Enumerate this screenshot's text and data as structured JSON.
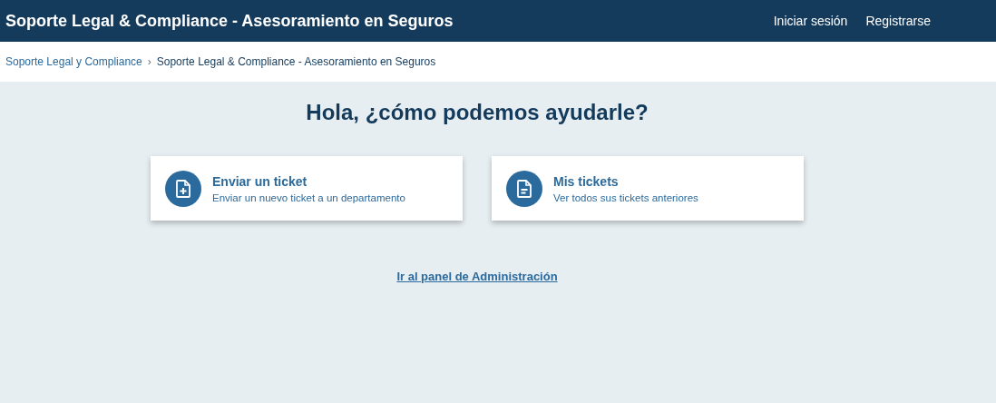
{
  "header": {
    "title": "Soporte Legal & Compliance - Asesoramiento en Seguros",
    "links": [
      "Iniciar sesión",
      "Registrarse"
    ]
  },
  "breadcrumb": {
    "items": [
      "Soporte Legal y Compliance",
      "Soporte Legal & Compliance - Asesoramiento en Seguros"
    ],
    "separator": "›"
  },
  "heading": "Hola, ¿cómo podemos ayudarle?",
  "cards": [
    {
      "kind": "new",
      "title": "Enviar un ticket",
      "subtitle": "Enviar un nuevo ticket a un departamento"
    },
    {
      "kind": "list",
      "title": "Mis tickets",
      "subtitle": "Ver todos sus tickets anteriores"
    }
  ],
  "admin_link": "Ir al panel de Administración"
}
